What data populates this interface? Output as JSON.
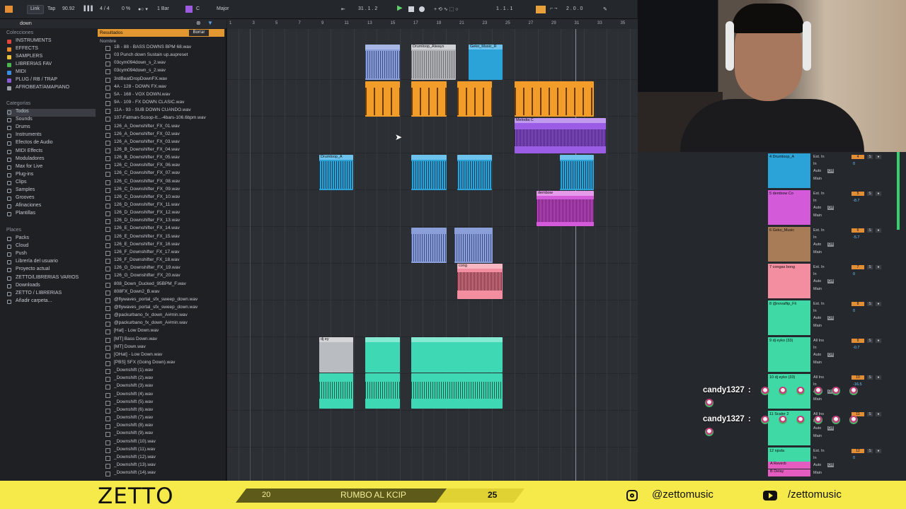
{
  "topbar": {
    "link": "Link",
    "tap": "Tap",
    "tempo": "90.92",
    "sig": "4 / 4",
    "cpu": "0 %",
    "bars": "1 Bar",
    "key": "C",
    "scale": "Major",
    "position": "31 .  1 .  2",
    "loop_start": "1 .  1 .  1",
    "loop_len": "2 .  0 .  0"
  },
  "browser": {
    "search": "down",
    "collections_title": "Colecciones",
    "collections": [
      {
        "label": "INSTRUMENTS",
        "color": "#e0453d"
      },
      {
        "label": "EFFECTS",
        "color": "#e58a2e"
      },
      {
        "label": "SAMPLERS",
        "color": "#e8c03a"
      },
      {
        "label": "LIBRERIAS FAV",
        "color": "#4bb54f"
      },
      {
        "label": "MIDI",
        "color": "#3a8fe0"
      },
      {
        "label": "PLUG / RB / TRAP",
        "color": "#8a5bd6"
      },
      {
        "label": "AFROBEAT/AMAPIANO",
        "color": "#9aa0a8"
      }
    ],
    "categories_title": "Categorías",
    "categories": [
      "Todos",
      "Sounds",
      "Drums",
      "Instruments",
      "Efectos de Audio",
      "MIDI Effects",
      "Moduladores",
      "Max for Live",
      "Plug-ins",
      "Clips",
      "Samples",
      "Grooves",
      "Afinaciones",
      "Plantillas"
    ],
    "places_title": "Places",
    "places": [
      "Packs",
      "Cloud",
      "Push",
      "Librería del usuario",
      "Proyecto actual",
      "ZETTO/LIBRERIAS VARIOS",
      "Downloads",
      "ZETTO / LIBRERIAS",
      "Añadir carpeta..."
    ],
    "results_label": "Resultados",
    "clear_label": "Borrar",
    "name_header": "Nombre",
    "files": [
      "1B - 88 - BASS DOWNS BPM 68.wav",
      "03 Punch down Sustain up.aupreset",
      "03cym094down_s_2.wav",
      "03cym094down_s_2.wav",
      "3rdBeatDropDownFX.wav",
      "4A - 128 - DOWN FX.wav",
      "5A - 168 - VOX DOWN.wav",
      "9A - 109 - FX DOWN CLASIC.wav",
      "11A - 93 - SUB DOWN CUANDO.wav",
      "107-Fatman-Scoop-It...-4bars-106.6bpm.wav",
      "126_A_Downshifter_FX_01.wav",
      "126_A_Downshifter_FX_02.wav",
      "126_A_Downshifter_FX_03.wav",
      "126_B_Downshifter_FX_04.wav",
      "126_B_Downshifter_FX_05.wav",
      "126_C_Downshifter_FX_06.wav",
      "126_C_Downshifter_FX_07.wav",
      "126_C_Downshifter_FX_08.wav",
      "126_C_Downshifter_FX_09.wav",
      "126_C_Downshifter_FX_10.wav",
      "126_D_Downshifter_FX_11.wav",
      "126_D_Downshifter_FX_12.wav",
      "126_D_Downshifter_FX_13.wav",
      "126_E_Downshifter_FX_14.wav",
      "126_E_Downshifter_FX_15.wav",
      "126_E_Downshifter_FX_16.wav",
      "126_F_Downshifter_FX_17.wav",
      "126_F_Downshifter_FX_18.wav",
      "126_G_Downshifter_FX_19.wav",
      "126_G_Downshifter_FX_20.wav",
      "808_Down_Ducked_95BPM_F.wav",
      "808FX_Down2_B.wav",
      "@flywaves_portal_sfx_sweep_down.wav",
      "@flywaves_portal_sfx_sweep_down.wav",
      "@packurbano_fx_down_A#min.wav",
      "@packurbano_fx_down_A#min.wav",
      "[Hat] - Low Down.wav",
      "[MT] Bass Down.wav",
      "[MT] Down.wav",
      "[OHat] - Low Down.wav",
      "[PBS] SFX (Going Down).wav",
      "_Downshift (1).wav",
      "_Downshift (2).wav",
      "_Downshift (3).wav",
      "_Downshift (4).wav",
      "_Downshift (5).wav",
      "_Downshift (6).wav",
      "_Downshift (7).wav",
      "_Downshift (8).wav",
      "_Downshift (9).wav",
      "_Downshift (10).wav",
      "_Downshift (11).wav",
      "_Downshift (12).wav",
      "_Downshift (13).wav",
      "_Downshift (14).wav"
    ]
  },
  "ruler": [
    "1",
    "3",
    "5",
    "7",
    "9",
    "11",
    "13",
    "15",
    "17",
    "19",
    "21",
    "23",
    "25",
    "27",
    "29",
    "31",
    "33",
    "35"
  ],
  "clips": {
    "drumloop": "Drumloop_Always",
    "geko": "Geko_Music_R",
    "melodia": "Melodia C",
    "dembow": "dembow",
    "drumloop2": "Drumloop_A",
    "congas": "cong",
    "dj": "dj ey"
  },
  "mixer": {
    "tracks": [
      {
        "name": "4 Drumloop_A",
        "num": "4",
        "color": "#2ba3d9",
        "input": "Ext. In",
        "vol": "0"
      },
      {
        "name": "5 dembow Co",
        "num": "5",
        "color": "#d35ad9",
        "input": "Ext. In",
        "vol": "-8.7"
      },
      {
        "name": "6 Geko_Music",
        "num": "6",
        "color": "#a77c56",
        "input": "Ext. In",
        "vol": "-5.7"
      },
      {
        "name": "7 congas bong",
        "num": "7",
        "color": "#f28ea0",
        "input": "Ext. In",
        "vol": "0"
      },
      {
        "name": "8 @novaflip_Fli",
        "num": "8",
        "color": "#3ed9a4",
        "input": "Ext. In",
        "vol": "0"
      },
      {
        "name": "9 dj eyko (33)",
        "num": "9",
        "color": "#3ed9a4",
        "input": "All Ins",
        "vol": "-0.7"
      },
      {
        "name": "10 dj eyko (33)",
        "num": "10",
        "color": "#3ed9a4",
        "input": "All Ins",
        "vol": "-16.5"
      },
      {
        "name": "11 Scaler 2",
        "num": "11",
        "color": "#3ed9a4",
        "input": "All Ins",
        "vol": "0"
      },
      {
        "name": "12 njoda",
        "num": "12",
        "color": "#3ed9a4",
        "input": "Ext. In",
        "vol": "0"
      }
    ],
    "returns": [
      "A Reverb",
      "B Delay"
    ],
    "channel": "All Channe",
    "auto": "Auto",
    "off": "Off",
    "main": "Main",
    "in": "In"
  },
  "chat": [
    {
      "user": "candy1327",
      "sep": ":"
    },
    {
      "user": "candy1327",
      "sep": ":"
    }
  ],
  "footer": {
    "brand": "ZETTO",
    "prog_start": "20",
    "prog_label": "RUMBO AL KCIP",
    "prog_end": "25",
    "progress": 0.72,
    "instagram": "@zettomusic",
    "youtube": "/zettomusic"
  },
  "colors": {
    "accent": "#f6e94a",
    "orange": "#f29c2a",
    "teal": "#3ed9b4",
    "purple": "#9b5de5"
  }
}
